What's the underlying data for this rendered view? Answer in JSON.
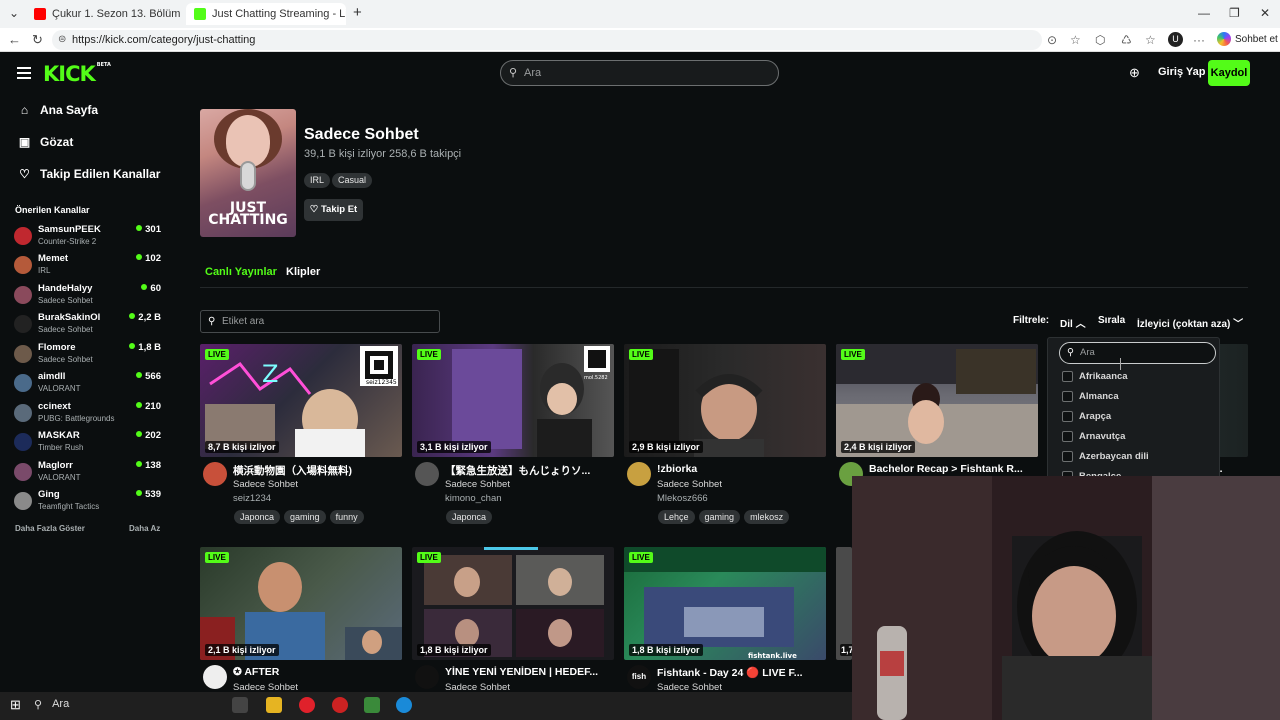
{
  "browser": {
    "tabs": [
      {
        "title": "Çukur 1. Sezon 13. Bölüm (Full HD)",
        "active": false
      },
      {
        "title": "Just Chatting Streaming - Live Stre",
        "active": true
      }
    ],
    "new_tab": "+",
    "url": "https://kick.com/category/just-chatting",
    "profile_initial": "U",
    "copilot_label": "Sohbet et"
  },
  "header": {
    "logo": "KICK",
    "logo_badge": "BETA",
    "search_placeholder": "Ara",
    "login": "Giriş Yap",
    "signup": "Kaydol"
  },
  "sidebar": {
    "nav": [
      {
        "label": "Ana Sayfa",
        "icon": "home-icon"
      },
      {
        "label": "Gözat",
        "icon": "browse-icon"
      },
      {
        "label": "Takip Edilen Kanallar",
        "icon": "heart-icon"
      }
    ],
    "recommended_title": "Önerilen Kanallar",
    "channels": [
      {
        "name": "SamsunPEEK",
        "category": "Counter-Strike 2",
        "viewers": "301"
      },
      {
        "name": "Memet",
        "category": "IRL",
        "viewers": "102"
      },
      {
        "name": "HandeHalyy",
        "category": "Sadece Sohbet",
        "viewers": "60"
      },
      {
        "name": "BurakSakinOl",
        "category": "Sadece Sohbet",
        "viewers": "2,2 B"
      },
      {
        "name": "Flomore",
        "category": "Sadece Sohbet",
        "viewers": "1,8 B"
      },
      {
        "name": "aimdll",
        "category": "VALORANT",
        "viewers": "566"
      },
      {
        "name": "ccinext",
        "category": "PUBG: Battlegrounds",
        "viewers": "210"
      },
      {
        "name": "MASKAR",
        "category": "Timber Rush",
        "viewers": "202"
      },
      {
        "name": "Maglorr",
        "category": "VALORANT",
        "viewers": "138"
      },
      {
        "name": "Ging",
        "category": "Teamfight Tactics",
        "viewers": "539"
      }
    ],
    "show_more": "Daha Fazla Göster",
    "show_less": "Daha Az"
  },
  "category": {
    "cover_line1": "JUST",
    "cover_line2": "CHATTING",
    "title": "Sadece Sohbet",
    "stats": "39,1 B kişi izliyor  258,6 B takipçi",
    "tags": [
      "IRL",
      "Casual"
    ],
    "follow": "Takip Et"
  },
  "tabs": {
    "live": "Canlı Yayınlar",
    "clips": "Klipler"
  },
  "toolbar": {
    "tag_search_placeholder": "Etiket ara",
    "filter_label": "Filtrele:",
    "filter_language": "Dil",
    "sort_label": "Sırala",
    "sort_value": "İzleyici (çoktan aza)"
  },
  "dropdown": {
    "search_placeholder": "Ara",
    "options": [
      "Afrikaanca",
      "Almanca",
      "Arapça",
      "Arnavutça",
      "Azerbaycan dili",
      "Bengalce"
    ]
  },
  "streams_row1": [
    {
      "viewers": "8,7 B kişi izliyor",
      "title": "横浜動物園（入場料無料)",
      "category": "Sadece Sohbet",
      "user": "seiz1234",
      "tags": [
        "Japonca",
        "gaming",
        "funny"
      ]
    },
    {
      "viewers": "3,1 B kişi izliyor",
      "title": "【緊急生放送】もんじょりソ...",
      "category": "Sadece Sohbet",
      "user": "kimono_chan",
      "tags": [
        "Japonca"
      ]
    },
    {
      "viewers": "2,9 B kişi izliyor",
      "title": "!zbiorka",
      "category": "Sadece Sohbet",
      "user": "Mlekosz666",
      "tags": [
        "Lehçe",
        "gaming",
        "mlekosz"
      ]
    },
    {
      "viewers": "2,4 B kişi izliyor",
      "title": "Bachelor Recap > Fishtank R...",
      "category": "",
      "user": "",
      "tags": []
    }
  ],
  "streams_row2": [
    {
      "viewers": "2,1 B kişi izliyor",
      "title": "✪ AFTER",
      "category": "Sadece Sohbet"
    },
    {
      "viewers": "1,8 B kişi izliyor",
      "title": "YİNE YENİ YENİDEN | HEDEF...",
      "category": "Sadece Sohbet"
    },
    {
      "viewers": "1,8 B kişi izliyor",
      "title": "Fishtank - Day 24 🔴 LIVE F...",
      "category": "Sadece Sohbet"
    }
  ],
  "live_badge": "LIVE",
  "partial_card": {
    "title_tail": "a...",
    "viewers_tail": "1,7"
  },
  "thumb_text": {
    "qr_caption_1": "seiz12345",
    "qr_caption_2": "mol.5282",
    "fishtank_watermark": "fishtank.live"
  },
  "taskbar": {
    "search": "Ara"
  }
}
